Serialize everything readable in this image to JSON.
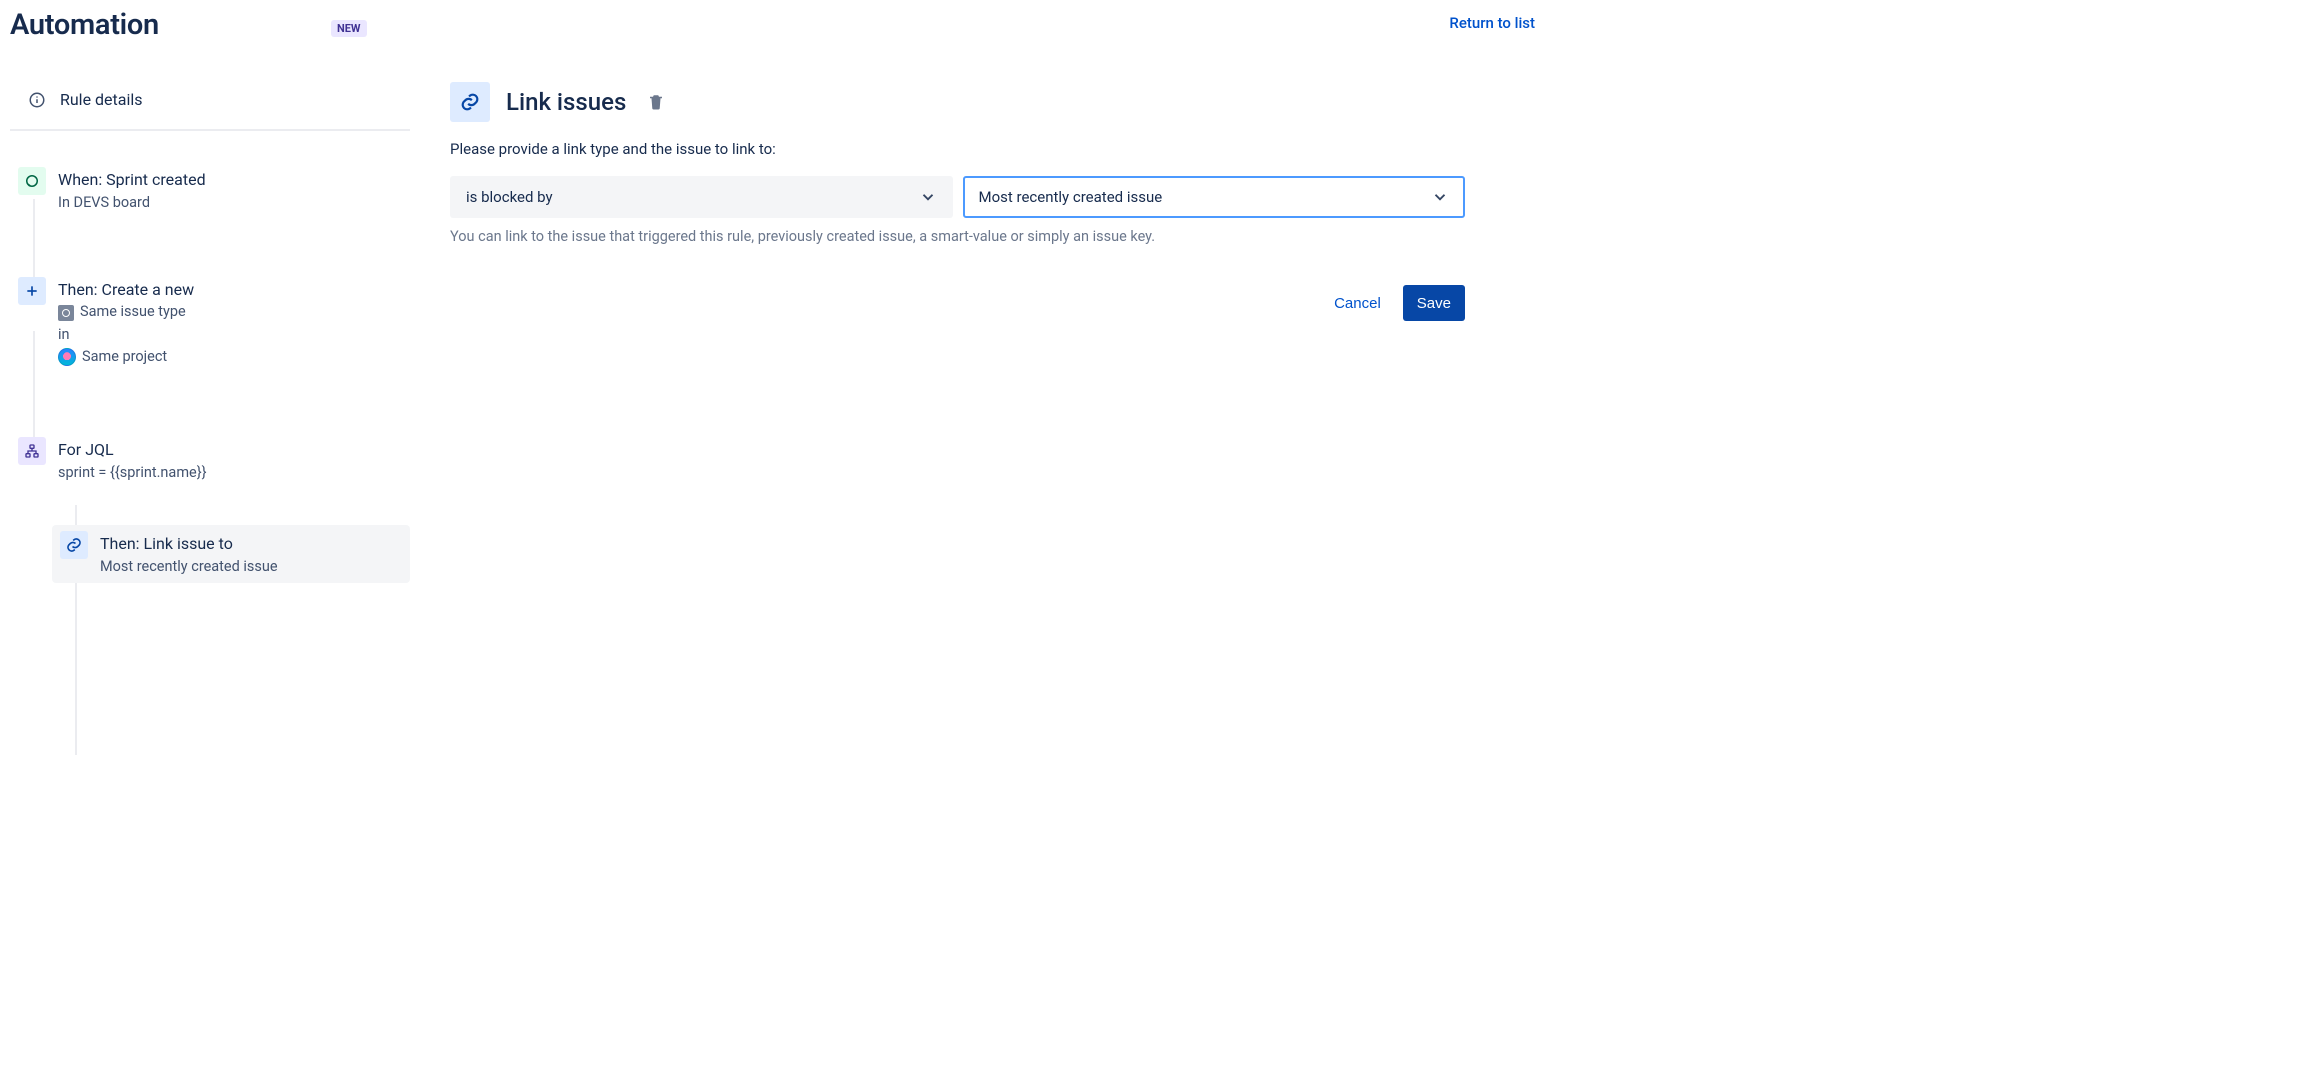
{
  "header": {
    "title": "Automation",
    "badge": "NEW",
    "return_link": "Return to list"
  },
  "sidebar": {
    "rule_details_label": "Rule details",
    "nodes": {
      "trigger": {
        "title": "When: Sprint created",
        "sub": "In DEVS board"
      },
      "action_create": {
        "title": "Then: Create a new",
        "issue_type": "Same issue type",
        "in_word": "in",
        "project": "Same project"
      },
      "branch": {
        "title": "For JQL",
        "sub": "sprint = {{sprint.name}}"
      },
      "action_link": {
        "title": "Then: Link issue to",
        "sub": "Most recently created issue"
      }
    }
  },
  "panel": {
    "title": "Link issues",
    "description": "Please provide a link type and the issue to link to:",
    "link_type": "is blocked by",
    "target_issue": "Most recently created issue",
    "helper": "You can link to the issue that triggered this rule, previously created issue, a smart-value or simply an issue key.",
    "cancel_label": "Cancel",
    "save_label": "Save"
  }
}
